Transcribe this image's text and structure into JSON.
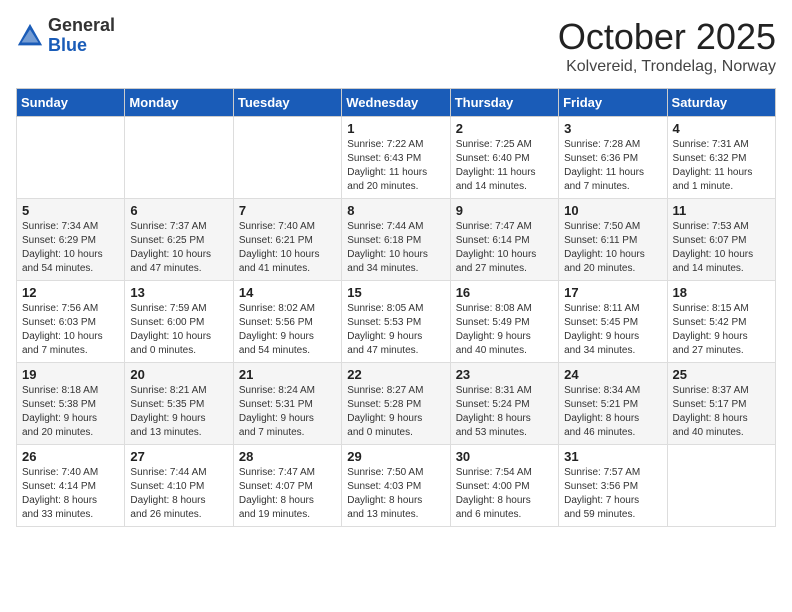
{
  "logo": {
    "general": "General",
    "blue": "Blue"
  },
  "header": {
    "month": "October 2025",
    "location": "Kolvereid, Trondelag, Norway"
  },
  "weekdays": [
    "Sunday",
    "Monday",
    "Tuesday",
    "Wednesday",
    "Thursday",
    "Friday",
    "Saturday"
  ],
  "weeks": [
    [
      {
        "day": "",
        "content": ""
      },
      {
        "day": "",
        "content": ""
      },
      {
        "day": "",
        "content": ""
      },
      {
        "day": "1",
        "content": "Sunrise: 7:22 AM\nSunset: 6:43 PM\nDaylight: 11 hours\nand 20 minutes."
      },
      {
        "day": "2",
        "content": "Sunrise: 7:25 AM\nSunset: 6:40 PM\nDaylight: 11 hours\nand 14 minutes."
      },
      {
        "day": "3",
        "content": "Sunrise: 7:28 AM\nSunset: 6:36 PM\nDaylight: 11 hours\nand 7 minutes."
      },
      {
        "day": "4",
        "content": "Sunrise: 7:31 AM\nSunset: 6:32 PM\nDaylight: 11 hours\nand 1 minute."
      }
    ],
    [
      {
        "day": "5",
        "content": "Sunrise: 7:34 AM\nSunset: 6:29 PM\nDaylight: 10 hours\nand 54 minutes."
      },
      {
        "day": "6",
        "content": "Sunrise: 7:37 AM\nSunset: 6:25 PM\nDaylight: 10 hours\nand 47 minutes."
      },
      {
        "day": "7",
        "content": "Sunrise: 7:40 AM\nSunset: 6:21 PM\nDaylight: 10 hours\nand 41 minutes."
      },
      {
        "day": "8",
        "content": "Sunrise: 7:44 AM\nSunset: 6:18 PM\nDaylight: 10 hours\nand 34 minutes."
      },
      {
        "day": "9",
        "content": "Sunrise: 7:47 AM\nSunset: 6:14 PM\nDaylight: 10 hours\nand 27 minutes."
      },
      {
        "day": "10",
        "content": "Sunrise: 7:50 AM\nSunset: 6:11 PM\nDaylight: 10 hours\nand 20 minutes."
      },
      {
        "day": "11",
        "content": "Sunrise: 7:53 AM\nSunset: 6:07 PM\nDaylight: 10 hours\nand 14 minutes."
      }
    ],
    [
      {
        "day": "12",
        "content": "Sunrise: 7:56 AM\nSunset: 6:03 PM\nDaylight: 10 hours\nand 7 minutes."
      },
      {
        "day": "13",
        "content": "Sunrise: 7:59 AM\nSunset: 6:00 PM\nDaylight: 10 hours\nand 0 minutes."
      },
      {
        "day": "14",
        "content": "Sunrise: 8:02 AM\nSunset: 5:56 PM\nDaylight: 9 hours\nand 54 minutes."
      },
      {
        "day": "15",
        "content": "Sunrise: 8:05 AM\nSunset: 5:53 PM\nDaylight: 9 hours\nand 47 minutes."
      },
      {
        "day": "16",
        "content": "Sunrise: 8:08 AM\nSunset: 5:49 PM\nDaylight: 9 hours\nand 40 minutes."
      },
      {
        "day": "17",
        "content": "Sunrise: 8:11 AM\nSunset: 5:45 PM\nDaylight: 9 hours\nand 34 minutes."
      },
      {
        "day": "18",
        "content": "Sunrise: 8:15 AM\nSunset: 5:42 PM\nDaylight: 9 hours\nand 27 minutes."
      }
    ],
    [
      {
        "day": "19",
        "content": "Sunrise: 8:18 AM\nSunset: 5:38 PM\nDaylight: 9 hours\nand 20 minutes."
      },
      {
        "day": "20",
        "content": "Sunrise: 8:21 AM\nSunset: 5:35 PM\nDaylight: 9 hours\nand 13 minutes."
      },
      {
        "day": "21",
        "content": "Sunrise: 8:24 AM\nSunset: 5:31 PM\nDaylight: 9 hours\nand 7 minutes."
      },
      {
        "day": "22",
        "content": "Sunrise: 8:27 AM\nSunset: 5:28 PM\nDaylight: 9 hours\nand 0 minutes."
      },
      {
        "day": "23",
        "content": "Sunrise: 8:31 AM\nSunset: 5:24 PM\nDaylight: 8 hours\nand 53 minutes."
      },
      {
        "day": "24",
        "content": "Sunrise: 8:34 AM\nSunset: 5:21 PM\nDaylight: 8 hours\nand 46 minutes."
      },
      {
        "day": "25",
        "content": "Sunrise: 8:37 AM\nSunset: 5:17 PM\nDaylight: 8 hours\nand 40 minutes."
      }
    ],
    [
      {
        "day": "26",
        "content": "Sunrise: 7:40 AM\nSunset: 4:14 PM\nDaylight: 8 hours\nand 33 minutes."
      },
      {
        "day": "27",
        "content": "Sunrise: 7:44 AM\nSunset: 4:10 PM\nDaylight: 8 hours\nand 26 minutes."
      },
      {
        "day": "28",
        "content": "Sunrise: 7:47 AM\nSunset: 4:07 PM\nDaylight: 8 hours\nand 19 minutes."
      },
      {
        "day": "29",
        "content": "Sunrise: 7:50 AM\nSunset: 4:03 PM\nDaylight: 8 hours\nand 13 minutes."
      },
      {
        "day": "30",
        "content": "Sunrise: 7:54 AM\nSunset: 4:00 PM\nDaylight: 8 hours\nand 6 minutes."
      },
      {
        "day": "31",
        "content": "Sunrise: 7:57 AM\nSunset: 3:56 PM\nDaylight: 7 hours\nand 59 minutes."
      },
      {
        "day": "",
        "content": ""
      }
    ]
  ]
}
